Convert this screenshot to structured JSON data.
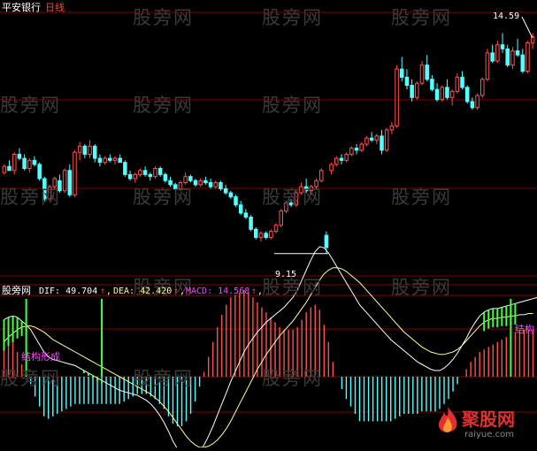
{
  "header": {
    "stock_name": "平安银行",
    "period": "日线"
  },
  "watermark": "股旁网",
  "markers": {
    "high_label": "14.59",
    "low_label": "9.15"
  },
  "indicator": {
    "name": "股旁网",
    "dif_label": "DIF: 49.704",
    "dea_label": "DEA: 42.420",
    "macd_label": "MACD: 14.568",
    "up_arrow": "↑",
    "separator": ",",
    "annotation_left": "结构形成",
    "annotation_right": "结构"
  },
  "logo": {
    "text": "聚股网",
    "sub": "raiyue.com"
  },
  "colors": {
    "up": "#ff5050",
    "down": "#54ffff",
    "signal_green": "#44ff44",
    "dif_line": "#ffffff",
    "dea_line": "#ffff99",
    "macd_label": "#ff44ff",
    "grid": "#800000"
  },
  "chart_data": [
    {
      "type": "candlestick",
      "title": "平安银行",
      "period": "日线",
      "ylim": [
        8.6,
        15.1
      ],
      "annotations": [
        {
          "label": "14.59",
          "index": 118,
          "value": 14.59
        },
        {
          "label": "9.15",
          "index": 64,
          "value": 9.15
        }
      ],
      "series": [
        {
          "name": "平安银行",
          "ohlc": [
            [
              11.15,
              11.35,
              11.1,
              11.3
            ],
            [
              11.3,
              11.45,
              11.2,
              11.2
            ],
            [
              11.2,
              11.65,
              11.1,
              11.6
            ],
            [
              11.6,
              11.75,
              11.45,
              11.5
            ],
            [
              11.5,
              11.6,
              11.2,
              11.25
            ],
            [
              11.25,
              11.5,
              11.15,
              11.45
            ],
            [
              11.45,
              11.55,
              11.3,
              11.35
            ],
            [
              11.35,
              11.4,
              10.95,
              11.0
            ],
            [
              11.0,
              11.05,
              10.45,
              10.5
            ],
            [
              10.5,
              10.85,
              10.45,
              10.8
            ],
            [
              10.8,
              11.05,
              10.75,
              11.0
            ],
            [
              10.95,
              11.1,
              10.65,
              10.7
            ],
            [
              10.7,
              11.25,
              10.65,
              11.2
            ],
            [
              11.2,
              11.35,
              10.55,
              10.6
            ],
            [
              10.6,
              11.7,
              10.55,
              11.65
            ],
            [
              11.65,
              11.9,
              11.45,
              11.8
            ],
            [
              11.8,
              11.85,
              11.5,
              11.6
            ],
            [
              11.6,
              11.95,
              11.5,
              11.8
            ],
            [
              11.8,
              11.85,
              11.4,
              11.5
            ],
            [
              11.5,
              11.6,
              11.3,
              11.4
            ],
            [
              11.4,
              11.55,
              11.35,
              11.5
            ],
            [
              11.5,
              11.6,
              11.4,
              11.45
            ],
            [
              11.45,
              11.55,
              11.35,
              11.5
            ],
            [
              11.5,
              11.6,
              11.4,
              11.4
            ],
            [
              11.4,
              11.45,
              11.05,
              11.1
            ],
            [
              11.1,
              11.2,
              10.95,
              11.0
            ],
            [
              11.0,
              11.15,
              10.9,
              11.1
            ],
            [
              11.1,
              11.25,
              11.05,
              11.2
            ],
            [
              11.2,
              11.3,
              11.05,
              11.1
            ],
            [
              11.1,
              11.15,
              10.95,
              11.05
            ],
            [
              11.05,
              11.3,
              11.0,
              11.25
            ],
            [
              11.25,
              11.3,
              11.05,
              11.1
            ],
            [
              11.1,
              11.15,
              10.9,
              10.95
            ],
            [
              10.95,
              11.05,
              10.8,
              10.85
            ],
            [
              10.85,
              10.9,
              10.7,
              10.75
            ],
            [
              10.75,
              10.95,
              10.7,
              10.9
            ],
            [
              10.9,
              11.15,
              10.85,
              11.05
            ],
            [
              11.05,
              11.1,
              10.9,
              10.95
            ],
            [
              10.95,
              11.0,
              10.8,
              10.85
            ],
            [
              10.85,
              11.0,
              10.8,
              10.95
            ],
            [
              10.95,
              11.05,
              10.85,
              10.9
            ],
            [
              10.9,
              11.0,
              10.75,
              10.8
            ],
            [
              10.8,
              10.95,
              10.75,
              10.9
            ],
            [
              10.9,
              10.95,
              10.7,
              10.75
            ],
            [
              10.75,
              10.85,
              10.6,
              10.65
            ],
            [
              10.65,
              10.7,
              10.5,
              10.55
            ],
            [
              10.55,
              10.6,
              10.3,
              10.35
            ],
            [
              10.35,
              10.45,
              10.1,
              10.15
            ],
            [
              10.15,
              10.25,
              10.0,
              10.05
            ],
            [
              10.05,
              10.1,
              9.7,
              9.75
            ],
            [
              9.75,
              9.8,
              9.5,
              9.55
            ],
            [
              9.55,
              9.7,
              9.45,
              9.65
            ],
            [
              9.65,
              9.7,
              9.5,
              9.55
            ],
            [
              9.55,
              9.75,
              9.5,
              9.7
            ],
            [
              9.7,
              9.9,
              9.65,
              9.85
            ],
            [
              9.85,
              10.25,
              9.8,
              10.2
            ],
            [
              10.2,
              10.45,
              10.15,
              10.4
            ],
            [
              10.4,
              10.5,
              10.3,
              10.35
            ],
            [
              10.35,
              10.7,
              10.3,
              10.65
            ],
            [
              10.65,
              10.9,
              10.6,
              10.8
            ],
            [
              10.8,
              11.0,
              10.65,
              10.7
            ],
            [
              10.7,
              10.85,
              10.6,
              10.8
            ],
            [
              10.8,
              11.0,
              10.75,
              10.95
            ],
            [
              10.95,
              11.25,
              10.9,
              11.2
            ],
            [
              9.6,
              9.7,
              9.15,
              9.3
            ],
            [
              11.2,
              11.4,
              11.1,
              11.35
            ],
            [
              11.35,
              11.55,
              11.3,
              11.5
            ],
            [
              11.5,
              11.6,
              11.35,
              11.45
            ],
            [
              11.45,
              11.65,
              11.4,
              11.6
            ],
            [
              11.6,
              11.8,
              11.55,
              11.75
            ],
            [
              11.75,
              11.85,
              11.6,
              11.7
            ],
            [
              11.7,
              11.9,
              11.65,
              11.85
            ],
            [
              11.85,
              12.05,
              11.8,
              12.0
            ],
            [
              12.0,
              12.15,
              11.9,
              11.95
            ],
            [
              11.95,
              12.1,
              11.85,
              12.05
            ],
            [
              12.05,
              12.2,
              11.6,
              11.7
            ],
            [
              11.7,
              12.25,
              11.65,
              12.2
            ],
            [
              12.2,
              12.4,
              12.1,
              12.3
            ],
            [
              12.3,
              13.8,
              12.25,
              13.7
            ],
            [
              13.7,
              14.0,
              13.4,
              13.5
            ],
            [
              13.5,
              13.7,
              13.2,
              13.3
            ],
            [
              13.3,
              13.45,
              12.9,
              13.0
            ],
            [
              13.0,
              13.4,
              12.95,
              13.35
            ],
            [
              13.35,
              13.9,
              13.3,
              13.8
            ],
            [
              13.8,
              14.05,
              13.4,
              13.45
            ],
            [
              13.45,
              13.55,
              13.15,
              13.2
            ],
            [
              13.2,
              13.35,
              12.9,
              12.95
            ],
            [
              12.95,
              13.3,
              12.9,
              13.25
            ],
            [
              13.25,
              13.45,
              12.95,
              13.0
            ],
            [
              13.0,
              13.2,
              12.8,
              13.15
            ],
            [
              13.15,
              13.6,
              13.1,
              13.5
            ],
            [
              13.5,
              13.65,
              13.2,
              13.25
            ],
            [
              13.25,
              13.3,
              12.85,
              12.9
            ],
            [
              12.9,
              13.0,
              12.7,
              12.75
            ],
            [
              12.75,
              13.1,
              12.7,
              13.05
            ],
            [
              13.05,
              13.5,
              13.0,
              13.45
            ],
            [
              13.45,
              14.2,
              13.4,
              14.1
            ],
            [
              14.1,
              14.3,
              13.85,
              13.9
            ],
            [
              13.9,
              14.4,
              13.85,
              14.3
            ],
            [
              14.3,
              14.59,
              14.1,
              14.2
            ],
            [
              14.2,
              14.3,
              13.75,
              13.8
            ],
            [
              13.8,
              14.25,
              13.7,
              14.15
            ],
            [
              14.15,
              14.45,
              14.0,
              14.05
            ],
            [
              14.05,
              14.2,
              13.6,
              13.65
            ],
            [
              13.65,
              14.4,
              13.6,
              14.35
            ],
            [
              14.35,
              14.59,
              14.2,
              14.5
            ]
          ]
        }
      ]
    },
    {
      "type": "bar+line",
      "title": "股旁网",
      "ylim": [
        -75,
        110
      ],
      "series": [
        {
          "name": "DIF",
          "values": [
            46,
            48,
            49,
            48,
            45,
            42,
            38,
            32,
            26,
            20,
            16,
            14,
            13,
            12,
            11,
            10,
            9,
            7,
            5,
            3,
            1,
            -1,
            -3,
            -5,
            -7,
            -9,
            -11,
            -12,
            -13,
            -14,
            -15,
            -17,
            -19,
            -22,
            -26,
            -31,
            -37,
            -44,
            -52,
            -58,
            -63,
            -66,
            -67,
            -65,
            -61,
            -55,
            -48,
            -40,
            -31,
            -22,
            -13,
            -4,
            4,
            12,
            20,
            26,
            31,
            36,
            40,
            44,
            47,
            50,
            53,
            56,
            60,
            64,
            70,
            78,
            86,
            94,
            101,
            105,
            104,
            100,
            94,
            88,
            82,
            76,
            70,
            64,
            58,
            54,
            50,
            46,
            42,
            38,
            34,
            30,
            27,
            24,
            21,
            18,
            15,
            12,
            10,
            8,
            6,
            5,
            5,
            7,
            10,
            14,
            19,
            25,
            31,
            38,
            44,
            49,
            52,
            54,
            55,
            55,
            56,
            57,
            58,
            59,
            60,
            61,
            62,
            63,
            64
          ]
        },
        {
          "name": "DEA",
          "values": [
            28,
            32,
            35,
            38,
            40,
            41,
            41,
            40,
            38,
            36,
            33,
            30,
            28,
            26,
            24,
            22,
            20,
            18,
            16,
            14,
            12,
            10,
            8,
            6,
            4,
            2,
            0,
            -2,
            -4,
            -6,
            -8,
            -10,
            -12,
            -14,
            -17,
            -20,
            -24,
            -28,
            -33,
            -38,
            -43,
            -48,
            -52,
            -55,
            -57,
            -57,
            -56,
            -54,
            -51,
            -47,
            -42,
            -36,
            -29,
            -22,
            -15,
            -8,
            -1,
            6,
            12,
            18,
            23,
            28,
            33,
            37,
            41,
            45,
            50,
            55,
            60,
            66,
            72,
            78,
            83,
            86,
            88,
            88,
            87,
            85,
            82,
            79,
            76,
            72,
            68,
            64,
            60,
            56,
            52,
            48,
            44,
            40,
            36,
            33,
            30,
            27,
            24,
            22,
            20,
            19,
            18,
            18,
            19,
            20,
            22,
            25,
            29,
            33,
            37,
            41,
            44,
            46,
            47,
            47,
            48,
            48,
            49,
            49,
            50,
            50,
            51,
            51
          ]
        },
        {
          "name": "MACD",
          "values": [
            36,
            32,
            28,
            20,
            10,
            2,
            -6,
            -16,
            -24,
            -32,
            -34,
            -32,
            -30,
            -28,
            -26,
            -24,
            -22,
            -22,
            -22,
            -22,
            -22,
            -22,
            -22,
            -22,
            -22,
            -22,
            -22,
            -20,
            -18,
            -16,
            -14,
            -14,
            -14,
            -16,
            -18,
            -22,
            -26,
            -32,
            -38,
            -40,
            -40,
            -36,
            -30,
            -20,
            -8,
            4,
            16,
            28,
            40,
            50,
            58,
            64,
            66,
            68,
            70,
            68,
            64,
            60,
            56,
            52,
            48,
            44,
            40,
            38,
            38,
            38,
            40,
            46,
            52,
            56,
            58,
            54,
            42,
            28,
            12,
            0,
            -10,
            -18,
            -24,
            -30,
            -36,
            -36,
            -36,
            -36,
            -36,
            -36,
            -36,
            -36,
            -34,
            -32,
            -30,
            -30,
            -30,
            -30,
            -28,
            -28,
            -28,
            -28,
            -26,
            -22,
            -18,
            -12,
            -6,
            0,
            6,
            12,
            16,
            20,
            22,
            24,
            26,
            28,
            30,
            32,
            34,
            36,
            38,
            38,
            38,
            38
          ]
        },
        {
          "name": "结构形成 signal",
          "indices": [
            5,
            22,
            114
          ]
        }
      ]
    }
  ]
}
